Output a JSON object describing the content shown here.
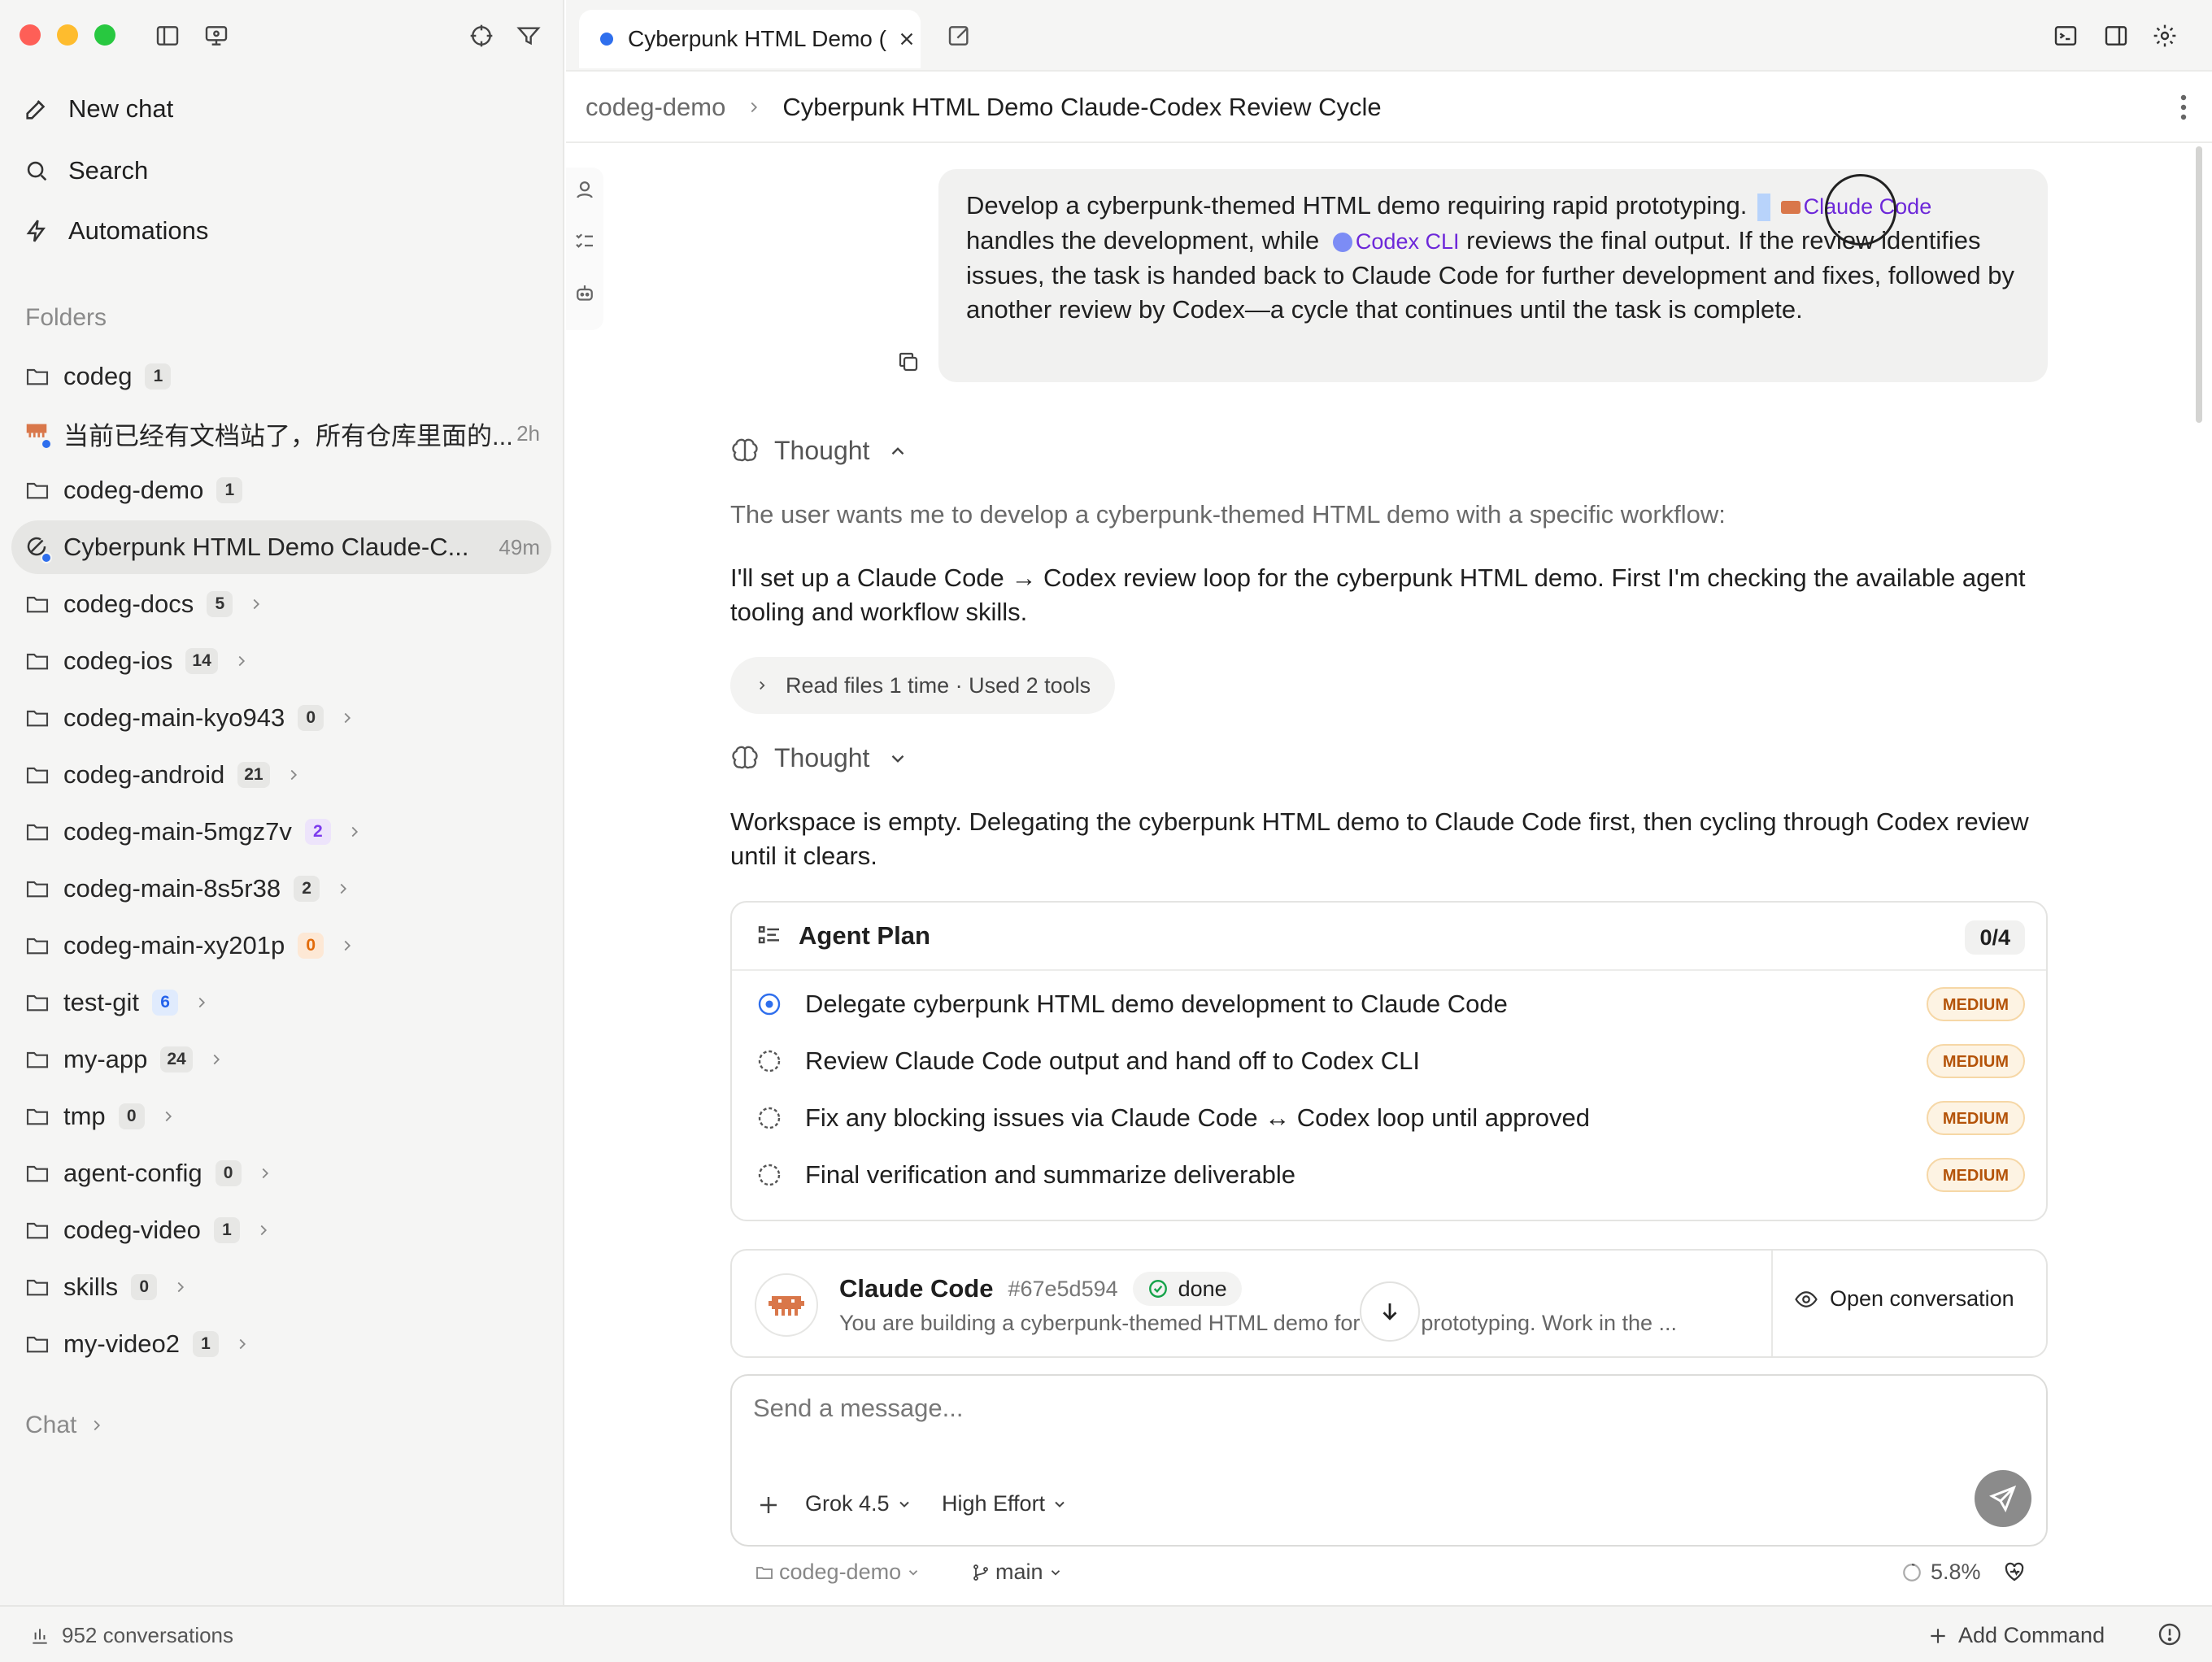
{
  "window": {
    "tab_title": "Cyberpunk HTML Demo (",
    "colors": {
      "close": "#fe5f57",
      "minimize": "#febc2e",
      "zoom": "#28c840",
      "accent_blue": "#2f6fed"
    }
  },
  "sidebar": {
    "nav": [
      {
        "label": "New chat",
        "icon": "compose-icon"
      },
      {
        "label": "Search",
        "icon": "search-icon"
      },
      {
        "label": "Automations",
        "icon": "bolt-icon"
      }
    ],
    "folders_label": "Folders",
    "folders": [
      {
        "name": "codeg",
        "count": "1",
        "badge": "gray"
      },
      {
        "name": "codeg-demo",
        "count": "1",
        "badge": "gray"
      },
      {
        "name": "codeg-docs",
        "count": "5",
        "badge": "gray"
      },
      {
        "name": "codeg-ios",
        "count": "14",
        "badge": "gray"
      },
      {
        "name": "codeg-main-kyo943",
        "count": "0",
        "badge": "gray"
      },
      {
        "name": "codeg-android",
        "count": "21",
        "badge": "gray"
      },
      {
        "name": "codeg-main-5mgz7v",
        "count": "2",
        "badge": "purple"
      },
      {
        "name": "codeg-main-8s5r38",
        "count": "2",
        "badge": "gray"
      },
      {
        "name": "codeg-main-xy201p",
        "count": "0",
        "badge": "orange"
      },
      {
        "name": "test-git",
        "count": "6",
        "badge": "blue"
      },
      {
        "name": "my-app",
        "count": "24",
        "badge": "gray"
      },
      {
        "name": "tmp",
        "count": "0",
        "badge": "gray"
      },
      {
        "name": "agent-config",
        "count": "0",
        "badge": "gray"
      },
      {
        "name": "codeg-video",
        "count": "1",
        "badge": "gray"
      },
      {
        "name": "skills",
        "count": "0",
        "badge": "gray"
      },
      {
        "name": "my-video2",
        "count": "1",
        "badge": "gray"
      }
    ],
    "conversations": [
      {
        "title": "当前已经有文档站了，所有仓库里面的...",
        "time": "2h"
      },
      {
        "title": "Cyberpunk HTML Demo Claude-C...",
        "time": "49m"
      }
    ],
    "chat_label": "Chat"
  },
  "header": {
    "breadcrumb_root": "codeg-demo",
    "breadcrumb_title": "Cyberpunk HTML Demo Claude-Codex Review Cycle"
  },
  "prompt": {
    "part1": "Develop a cyberpunk-themed HTML demo requiring rapid prototyping.",
    "mention_claude": "Claude Code",
    "part2": "handles the development, while",
    "mention_codex": "Codex CLI",
    "part3": "reviews the final output. If the review identifies issues, the task is handed back to Claude Code for further development and fixes, followed by another review by Codex—a cycle that continues until the task is complete."
  },
  "thread": {
    "thought_label": "Thought",
    "thought1_text": "The user wants me to develop a cyberpunk-themed HTML demo with a specific workflow:",
    "answer1": "I'll set up a Claude Code → Codex review loop for the cyberpunk HTML demo. First I'm checking the available agent tooling and workflow skills.",
    "tools_summary": "Read files 1 time · Used 2 tools",
    "answer2": "Workspace is empty. Delegating the cyberpunk HTML demo to Claude Code first, then cycling through Codex review until it clears."
  },
  "plan": {
    "title": "Agent Plan",
    "count": "0/4",
    "items": [
      {
        "text": "Delegate cyberpunk HTML demo development to Claude Code",
        "priority": "MEDIUM",
        "status": "in_progress"
      },
      {
        "text": "Review Claude Code output and hand off to Codex CLI",
        "priority": "MEDIUM",
        "status": "pending"
      },
      {
        "text": "Fix any blocking issues via Claude Code ↔ Codex loop until approved",
        "priority": "MEDIUM",
        "status": "pending"
      },
      {
        "text": "Final verification and summarize deliverable",
        "priority": "MEDIUM",
        "status": "pending"
      }
    ]
  },
  "agent_card": {
    "name": "Claude Code",
    "hash": "#67e5d594",
    "status": "done",
    "preview": "You are building a cyberpunk-themed HTML demo for rapid prototyping. Work in the ...",
    "open_label": "Open conversation"
  },
  "composer": {
    "placeholder": "Send a message...",
    "model": "Grok 4.5",
    "effort": "High Effort",
    "folder": "codeg-demo",
    "branch": "main",
    "context": "5.8%"
  },
  "statusbar": {
    "conversations": "952 conversations",
    "add_command": "Add Command"
  }
}
